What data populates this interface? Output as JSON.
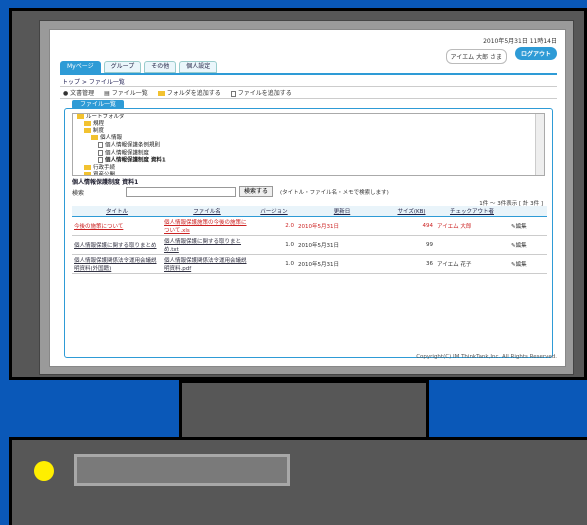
{
  "header": {
    "date": "2010年5月31日 11時14日",
    "user": "アイエム 大郎 さま",
    "logout": "ログアウト"
  },
  "tabs": [
    "Myページ",
    "グループ",
    "その他",
    "個人設定"
  ],
  "breadcrumb": "トップ > ファイル一覧",
  "toolbar": {
    "title": "文書管理",
    "file_list": "ファイル一覧",
    "add_folder": "フォルダを追加する",
    "add_file": "ファイルを追加する"
  },
  "panel_tab": "ファイル一覧",
  "tree": [
    {
      "label": "ルートフォルダ",
      "type": "folder",
      "level": 0
    },
    {
      "label": "規程",
      "type": "folder",
      "level": 1
    },
    {
      "label": "制度",
      "type": "folder",
      "level": 1
    },
    {
      "label": "個人情報",
      "type": "folder",
      "level": 2
    },
    {
      "label": "個人情報保護条例規則",
      "type": "doc",
      "level": 3
    },
    {
      "label": "個人情報保護制度",
      "type": "doc",
      "level": 3
    },
    {
      "label": "個人情報保護制度 資料1",
      "type": "doc",
      "level": 3,
      "bold": true
    },
    {
      "label": "行政手続",
      "type": "folder",
      "level": 1
    },
    {
      "label": "資産公開",
      "type": "folder",
      "level": 1
    },
    {
      "label": "情報公開",
      "type": "folder",
      "level": 1
    }
  ],
  "section_title": "個人情報保護制度 資料1",
  "search": {
    "label": "検索",
    "button": "検索する",
    "note": "(タイトル・ファイル名・メモで検索します)"
  },
  "count": "1件 ～ 3件表示 [ 計 3件 ]",
  "table": {
    "headers": [
      "タイトル",
      "ファイル名",
      "バージョン",
      "更新日",
      "サイズ(KB)",
      "チェックアウト者",
      ""
    ],
    "rows": [
      {
        "title": "今後の施策について",
        "file": "個人情報保護施策の今後の施策について.xls",
        "version": "2.0",
        "date": "2010年5月31日",
        "size": "494",
        "checkout": "アイエム 大郎",
        "action": "編集",
        "red": true
      },
      {
        "title": "個人情報保護に関する取りまとめ",
        "file": "個人情報保護に関する取りまとめ.txt",
        "version": "1.0",
        "date": "2010年5月31日",
        "size": "99",
        "checkout": "",
        "action": "編集",
        "red": false
      },
      {
        "title": "個人情報保護関係法令運用会議説明資料(外国籍)",
        "file": "個人情報保護関係法令運用会議説明資料.pdf",
        "version": "1.0",
        "date": "2010年5月31日",
        "size": "36",
        "checkout": "アイエム 花子",
        "action": "編集",
        "red": false
      }
    ]
  },
  "copyright": "Copyright(C) IM ThinkTank,Inc. All Rights Reserved.",
  "colors": {
    "accent": "#2e9bd6",
    "background": "#0a58b8",
    "monitor": "#575757",
    "led": "#ffef00"
  }
}
